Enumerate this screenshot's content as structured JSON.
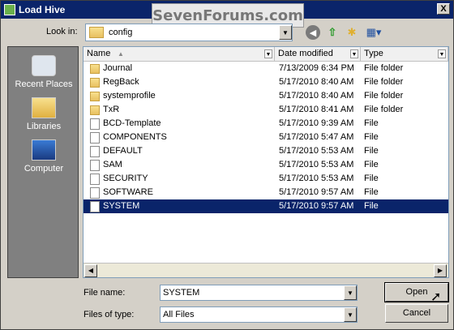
{
  "window": {
    "title": "Load Hive",
    "watermark": "SevenForums.com",
    "close_glyph": "X"
  },
  "lookin": {
    "label": "Look in:",
    "value": "config",
    "dropdown_glyph": "▼"
  },
  "toolbar": {
    "back_glyph": "◀",
    "up_glyph": "⇧",
    "new_folder_glyph": "✱",
    "view_glyph": "▦▾"
  },
  "places": [
    {
      "label": "Recent Places"
    },
    {
      "label": "Libraries"
    },
    {
      "label": "Computer"
    }
  ],
  "columns": [
    {
      "label": "Name",
      "sort_glyph": "▲",
      "arrow_glyph": "▼"
    },
    {
      "label": "Date modified",
      "arrow_glyph": "▼"
    },
    {
      "label": "Type",
      "arrow_glyph": "▼"
    }
  ],
  "files": [
    {
      "name": "Journal",
      "date": "7/13/2009 6:34 PM",
      "type": "File folder",
      "kind": "folder"
    },
    {
      "name": "RegBack",
      "date": "5/17/2010 8:40 AM",
      "type": "File folder",
      "kind": "folder"
    },
    {
      "name": "systemprofile",
      "date": "5/17/2010 8:40 AM",
      "type": "File folder",
      "kind": "folder"
    },
    {
      "name": "TxR",
      "date": "5/17/2010 8:41 AM",
      "type": "File folder",
      "kind": "folder"
    },
    {
      "name": "BCD-Template",
      "date": "5/17/2010 9:39 AM",
      "type": "File",
      "kind": "file"
    },
    {
      "name": "COMPONENTS",
      "date": "5/17/2010 5:47 AM",
      "type": "File",
      "kind": "file"
    },
    {
      "name": "DEFAULT",
      "date": "5/17/2010 5:53 AM",
      "type": "File",
      "kind": "file"
    },
    {
      "name": "SAM",
      "date": "5/17/2010 5:53 AM",
      "type": "File",
      "kind": "file"
    },
    {
      "name": "SECURITY",
      "date": "5/17/2010 5:53 AM",
      "type": "File",
      "kind": "file"
    },
    {
      "name": "SOFTWARE",
      "date": "5/17/2010 9:57 AM",
      "type": "File",
      "kind": "file"
    },
    {
      "name": "SYSTEM",
      "date": "5/17/2010 9:57 AM",
      "type": "File",
      "kind": "file",
      "selected": true
    }
  ],
  "scroll": {
    "left_glyph": "◀",
    "right_glyph": "▶"
  },
  "filename": {
    "label": "File name:",
    "value": "SYSTEM",
    "dropdown_glyph": "▼"
  },
  "filetype": {
    "label": "Files of type:",
    "value": "All Files",
    "dropdown_glyph": "▼"
  },
  "buttons": {
    "open": "Open",
    "cancel": "Cancel"
  },
  "colors": {
    "selection": "#0a246a",
    "titlebar": "#0a246a",
    "places_bg": "#808080"
  }
}
